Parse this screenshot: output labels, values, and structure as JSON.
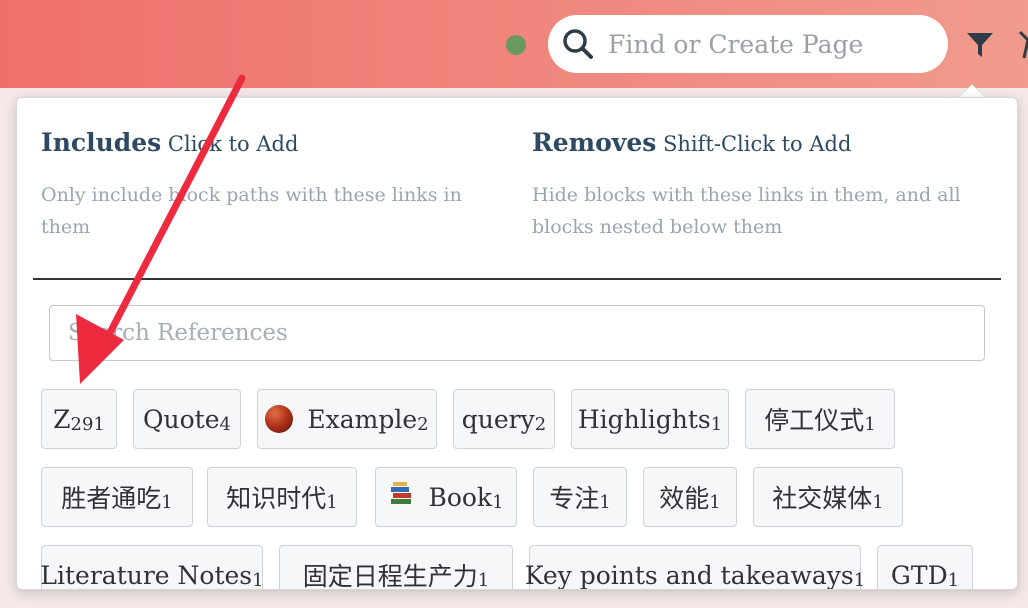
{
  "topbar": {
    "search_placeholder": "Find or Create Page",
    "accent": "#ef6f6c"
  },
  "filter_panel": {
    "includes": {
      "title": "Includes",
      "hint": "Click to Add",
      "description": "Only include block paths with these links in them"
    },
    "removes": {
      "title": "Removes",
      "hint": "Shift-Click to Add",
      "description": "Hide blocks with these links in them, and all blocks nested below them"
    },
    "ref_search_placeholder": "Search References",
    "chips": [
      {
        "label": "Z",
        "count": "291",
        "icon": null
      },
      {
        "label": "Quote",
        "count": "4",
        "icon": null
      },
      {
        "label": "Example",
        "count": "2",
        "icon": "red-ball-icon"
      },
      {
        "label": "query",
        "count": "2",
        "icon": null
      },
      {
        "label": "Highlights",
        "count": "1",
        "icon": null
      },
      {
        "label": "停工仪式",
        "count": "1",
        "icon": null
      },
      {
        "label": "胜者通吃",
        "count": "1",
        "icon": null
      },
      {
        "label": "知识时代",
        "count": "1",
        "icon": null
      },
      {
        "label": "Book",
        "count": "1",
        "icon": "books-icon"
      },
      {
        "label": "专注",
        "count": "1",
        "icon": null
      },
      {
        "label": "效能",
        "count": "1",
        "icon": null
      },
      {
        "label": "社交媒体",
        "count": "1",
        "icon": null
      },
      {
        "label": "Literature Notes",
        "count": "1",
        "icon": null
      },
      {
        "label": "固定日程生产力",
        "count": "1",
        "icon": null
      },
      {
        "label": "Key points and takeaways",
        "count": "1",
        "icon": null
      },
      {
        "label": "GTD",
        "count": "1",
        "icon": null
      }
    ]
  },
  "annotation": {
    "arrow_color": "#ee2a3f"
  }
}
